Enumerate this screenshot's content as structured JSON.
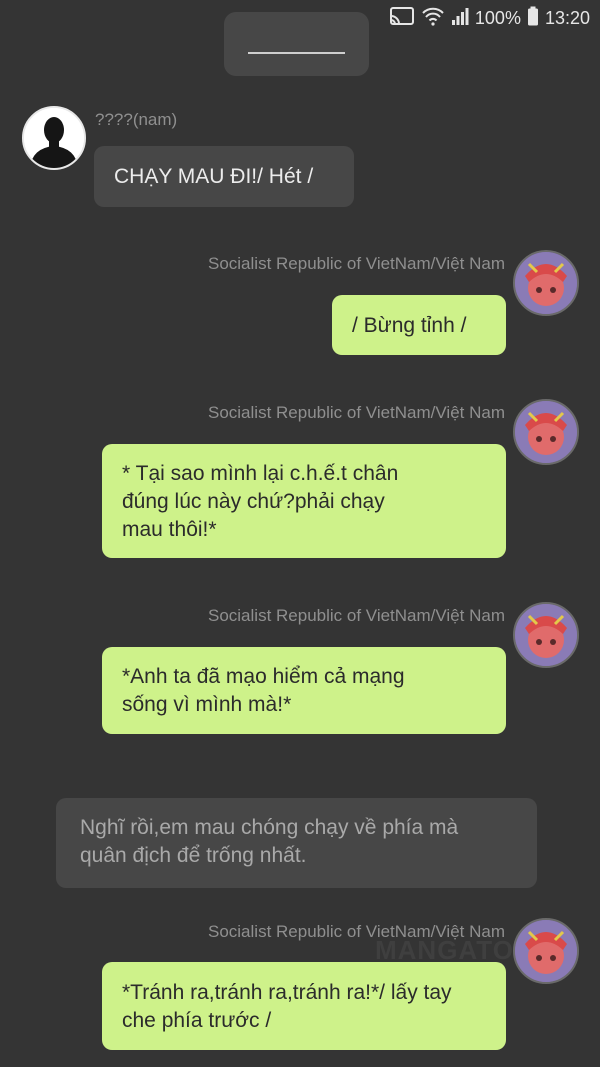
{
  "status_bar": {
    "battery": "100%",
    "time": "13:20",
    "icons": [
      "cast-icon",
      "wifi-icon",
      "signal-icon",
      "battery-icon"
    ]
  },
  "messages": [
    {
      "sender": "????(nam)",
      "text": "CHẠY MAU ĐI!/ Hét /"
    },
    {
      "sender": "Socialist Republic of VietNam/Việt  Nam",
      "text": "/ Bừng tỉnh /"
    },
    {
      "sender": "Socialist Republic of VietNam/Việt  Nam",
      "text": "* Tại sao mình lại c.h.ế.t chân\nđúng lúc này chứ?phải chạy\nmau thôi!*"
    },
    {
      "sender": "Socialist Republic of VietNam/Việt  Nam",
      "text": "*Anh ta đã mạo hiểm cả mạng\nsống vì mình mà!*"
    },
    {
      "sender": "",
      "text": "Nghĩ rồi,em mau chóng chạy về phía mà\nquân địch để trống nhất."
    },
    {
      "sender": "Socialist Republic of VietNam/Việt  Nam",
      "text": "*Tránh ra,tránh ra,tránh ra!*/ lấy tay\nche phía trước /"
    }
  ],
  "watermark": "MANGATO",
  "colors": {
    "background": "#343434",
    "bubble_dark": "#474747",
    "bubble_green": "#cef28a",
    "name_text": "#8f8f8f"
  }
}
